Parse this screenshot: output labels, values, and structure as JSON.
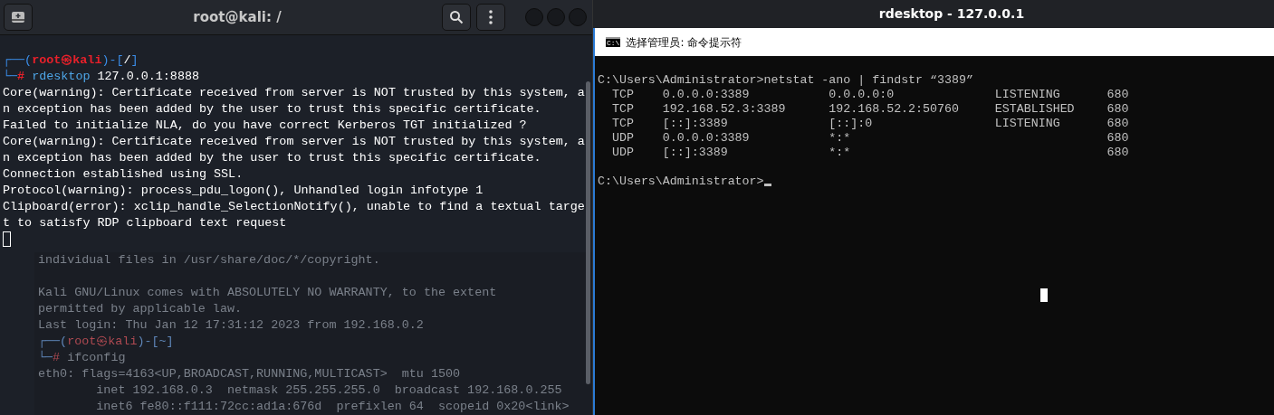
{
  "terminal": {
    "title": "root@kali: /",
    "prompt": {
      "open": "┌──(",
      "user": "root㉿kali",
      "close": ")-[",
      "dir": "/",
      "end": "]",
      "corner": "└─",
      "hash": "#",
      "command": "rdesktop",
      "args": " 127.0.0.1:8888"
    },
    "output": [
      "Core(warning): Certificate received from server is NOT trusted by this system, a",
      "n exception has been added by the user to trust this specific certificate.",
      "Failed to initialize NLA, do you have correct Kerberos TGT initialized ?",
      "Core(warning): Certificate received from server is NOT trusted by this system, a",
      "n exception has been added by the user to trust this specific certificate.",
      "Connection established using SSL.",
      "Protocol(warning): process_pdu_logon(), Unhandled login infotype 1",
      "Clipboard(error): xclip_handle_SelectionNotify(), unable to find a textual targe",
      "t to satisfy RDP clipboard text request"
    ],
    "background_lines": [
      {
        "kind": "text",
        "text": "individual files in /usr/share/doc/*/copyright."
      },
      {
        "kind": "blank"
      },
      {
        "kind": "text",
        "text": "Kali GNU/Linux comes with ABSOLUTELY NO WARRANTY, to the extent"
      },
      {
        "kind": "text",
        "text": "permitted by applicable law."
      },
      {
        "kind": "text",
        "text": "Last login: Thu Jan 12 17:31:12 2023 from 192.168.0.2"
      },
      {
        "kind": "prompt",
        "open": "┌──(",
        "user": "root㉿kali",
        "close": ")-[~]"
      },
      {
        "kind": "command",
        "corner": "└─",
        "hash": "#",
        "text": "ifconfig"
      },
      {
        "kind": "text",
        "text": "eth0: flags=4163<UP,BROADCAST,RUNNING,MULTICAST>  mtu 1500"
      },
      {
        "kind": "text",
        "text": "        inet 192.168.0.3  netmask 255.255.255.0  broadcast 192.168.0.255"
      },
      {
        "kind": "text",
        "text": "        inet6 fe80::f111:72cc:ad1a:676d  prefixlen 64  scopeid 0x20<link>"
      }
    ]
  },
  "rdesktop": {
    "title": "rdesktop - 127.0.0.1",
    "cmd": {
      "title": "选择管理员: 命令提示符",
      "icon_text": "C:\\",
      "command_line": "C:\\Users\\Administrator>netstat -ano | findstr “3389”",
      "rows": [
        {
          "proto": "TCP",
          "local": "0.0.0.0:3389",
          "foreign": "0.0.0.0:0",
          "state": "LISTENING",
          "pid": "680"
        },
        {
          "proto": "TCP",
          "local": "192.168.52.3:3389",
          "foreign": "192.168.52.2:50760",
          "state": "ESTABLISHED",
          "pid": "680"
        },
        {
          "proto": "TCP",
          "local": "[::]:3389",
          "foreign": "[::]:0",
          "state": "LISTENING",
          "pid": "680"
        },
        {
          "proto": "UDP",
          "local": "0.0.0.0:3389",
          "foreign": "*:*",
          "pid": "680"
        },
        {
          "proto": "UDP",
          "local": "[::]:3389",
          "foreign": "*:*",
          "pid": "680"
        }
      ],
      "prompt": "C:\\Users\\Administrator>"
    }
  }
}
